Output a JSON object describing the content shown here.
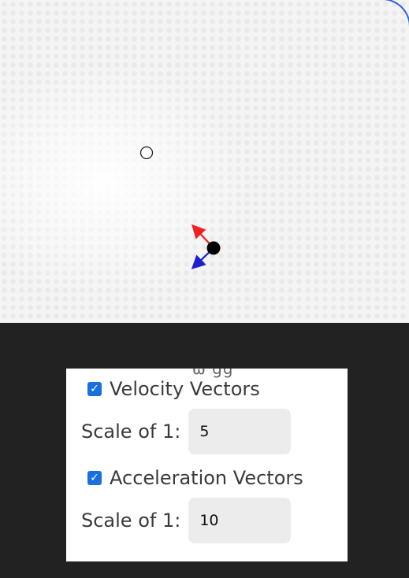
{
  "simulation": {
    "colors": {
      "velocity_arrow": "#ee2222",
      "acceleration_arrow": "#2020cc",
      "accent_border": "#2b63d9"
    }
  },
  "controls": {
    "clipped_heading": "ω  gg",
    "velocity": {
      "checkbox_checked": true,
      "label": "Velocity Vectors",
      "scale_label": "Scale of 1:",
      "scale_value": "5"
    },
    "acceleration": {
      "checkbox_checked": true,
      "label": "Acceleration Vectors",
      "scale_label": "Scale of 1:",
      "scale_value": "10"
    }
  }
}
